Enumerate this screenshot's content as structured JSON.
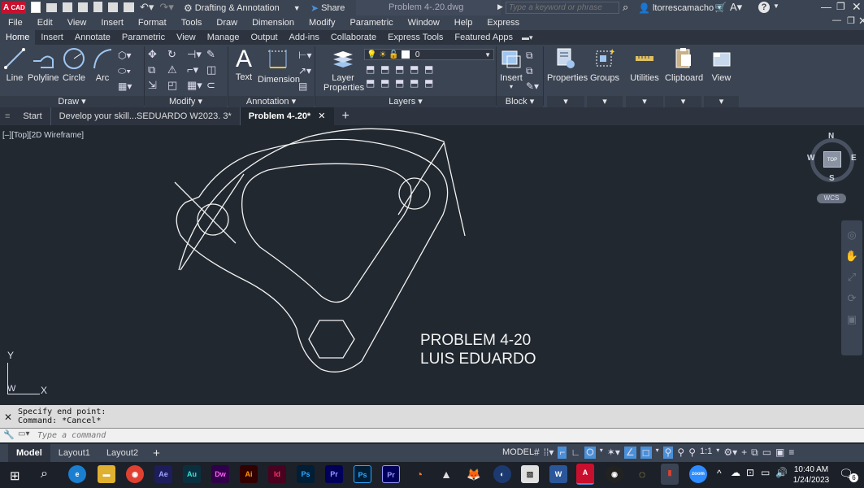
{
  "titlebar": {
    "app_badge": "CAD",
    "workspace": "Drafting & Annotation",
    "share": "Share",
    "file_title": "Problem 4-.20.dwg",
    "search_placeholder": "Type a keyword or phrase",
    "user": "ltorrescamacho"
  },
  "menu": [
    "File",
    "Edit",
    "View",
    "Insert",
    "Format",
    "Tools",
    "Draw",
    "Dimension",
    "Modify",
    "Parametric",
    "Window",
    "Help",
    "Express"
  ],
  "ribbon_tabs": [
    "Home",
    "Insert",
    "Annotate",
    "Parametric",
    "View",
    "Manage",
    "Output",
    "Add-ins",
    "Collaborate",
    "Express Tools",
    "Featured Apps"
  ],
  "ribbon": {
    "draw_tools": [
      "Line",
      "Polyline",
      "Circle",
      "Arc"
    ],
    "draw_title": "Draw",
    "modify_title": "Modify",
    "text": "Text",
    "dimension": "Dimension",
    "annotation_title": "Annotation",
    "layer_properties": "Layer\nProperties",
    "layer_line1": "Layer",
    "layer_line2": "Properties",
    "layer_current": "0",
    "layers_title": "Layers",
    "insert": "Insert",
    "block_title": "Block",
    "properties": "Properties",
    "groups": "Groups",
    "utilities": "Utilities",
    "clipboard": "Clipboard",
    "view": "View"
  },
  "doc_tabs": [
    "Start",
    "Develop your skill...SEDUARDO W2023. 3*",
    "Problem 4-.20*"
  ],
  "viewport": {
    "label": "[–][Top][2D Wireframe]",
    "drawing_text_line1": "PROBLEM 4-20",
    "drawing_text_line2": "LUIS EDUARDO",
    "compass": {
      "n": "N",
      "s": "S",
      "e": "E",
      "w": "W",
      "top": "TOP",
      "wcs": "WCS"
    },
    "ucs": {
      "y": "Y",
      "x": "X",
      "w": "W"
    }
  },
  "command": {
    "line1": "Specify end point:",
    "line2": "Command: *Cancel*",
    "placeholder": "Type a command"
  },
  "status": {
    "tabs": [
      "Model",
      "Layout1",
      "Layout2"
    ],
    "model": "MODEL",
    "scale": "1:1"
  },
  "taskbar": {
    "apps": [
      "Ae",
      "Au",
      "Dw",
      "Ai",
      "Id",
      "Ps",
      "Pr",
      "Ps",
      "Pr"
    ],
    "time": "10:40 AM",
    "date": "1/24/2023",
    "notifications": "6"
  },
  "colors": {
    "drawing_bg": "#212830",
    "ribbon_bg": "#3b4453",
    "accent_blue": "#4a90d9",
    "autocad_red": "#c8102e"
  }
}
